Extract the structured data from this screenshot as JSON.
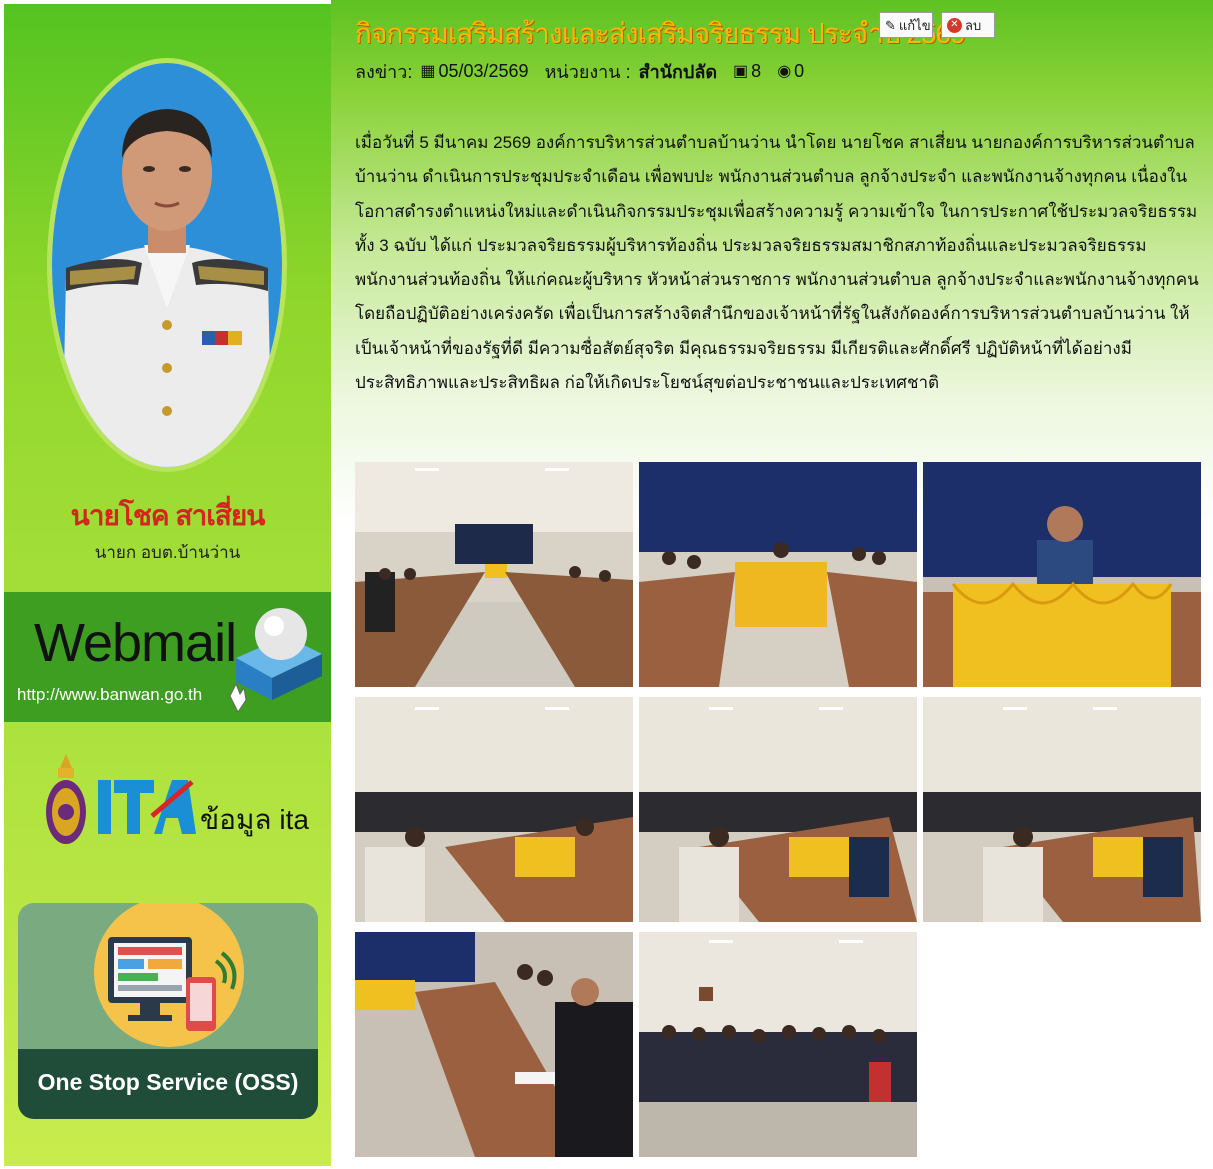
{
  "sidebar": {
    "mayor_name": "นายโชค สาเสี่ยน",
    "mayor_title": "นายก อบต.บ้านว่าน",
    "webmail": {
      "title": "Webmail",
      "url": "http://www.banwan.go.th"
    },
    "ita": {
      "logo_text": "ITA",
      "label": "ข้อมูล ita"
    },
    "oss": {
      "label": "One Stop Service (OSS)"
    }
  },
  "article": {
    "title": "กิจกรรมเสริมสร้างและส่งเสริมจริยธรรม ประจำปี 2569",
    "edit_label": "แก้ไข",
    "delete_label": "ลบ",
    "meta": {
      "posted_label": "ลงข่าว:",
      "date": "05/03/2569",
      "agency_label": "หน่วยงาน :",
      "agency": "สำนักปลัด",
      "image_count": "8",
      "view_count": "0"
    },
    "body": "เมื่อวันที่ 5 มีนาคม 2569 องค์การบริหารส่วนตำบลบ้านว่าน นำโดย นายโชค สาเสี่ยน นายกองค์การบริหารส่วนตำบลบ้านว่าน ดำเนินการประชุมประจำเดือน เพื่อพบปะ พนักงานส่วนตำบล ลูกจ้างประจำ และพนักงานจ้างทุกคน เนื่องในโอกาสดำรงตำแหน่งใหม่และดำเนินกิจกรรมประชุมเพื่อสร้างความรู้ ความเข้าใจ ในการประกาศใช้ประมวลจริยธรรม ทั้ง 3 ฉบับ ได้แก่ ประมวลจริยธรรมผู้บริหารท้องถิ่น ประมวลจริยธรรมสมาชิกสภาท้องถิ่นและประมวลจริยธรรมพนักงานส่วนท้องถิ่น ให้แก่คณะผู้บริหาร หัวหน้าส่วนราชการ พนักงานส่วนตำบล ลูกจ้างประจำและพนักงานจ้างทุกคน โดยถือปฏิบัติอย่างเคร่งครัด เพื่อเป็นการสร้างจิตสำนึกของเจ้าหน้าที่รัฐในสังกัดองค์การบริหารส่วนตำบลบ้านว่าน ให้เป็นเจ้าหน้าที่ของรัฐที่ดี มีความซื่อสัตย์สุจริต มีคุณธรรมจริยธรรม มีเกียรติและศักดิ์ศรี ปฏิบัติหน้าที่ได้อย่างมีประสิทธิภาพและประสิทธิผล ก่อให้เกิดประโยชน์สุขต่อประชาชนและประเทศชาติ"
  },
  "gallery": {
    "photos": [
      {
        "scene": "hall-wide-tables"
      },
      {
        "scene": "head-table-gold-skirt"
      },
      {
        "scene": "speaker-closeup"
      },
      {
        "scene": "audience-rows"
      },
      {
        "scene": "audience-rows"
      },
      {
        "scene": "audience-rows"
      },
      {
        "scene": "long-table-side"
      },
      {
        "scene": "group-standing"
      }
    ]
  },
  "colors": {
    "sidebar_green": "#8fd62b",
    "title_orange": "#ffb600",
    "mayor_name_red": "#d2261f",
    "webmail_band": "#3e9e22",
    "oss_dark": "#1f4d3a",
    "oss_yellow": "#f5c34a"
  }
}
